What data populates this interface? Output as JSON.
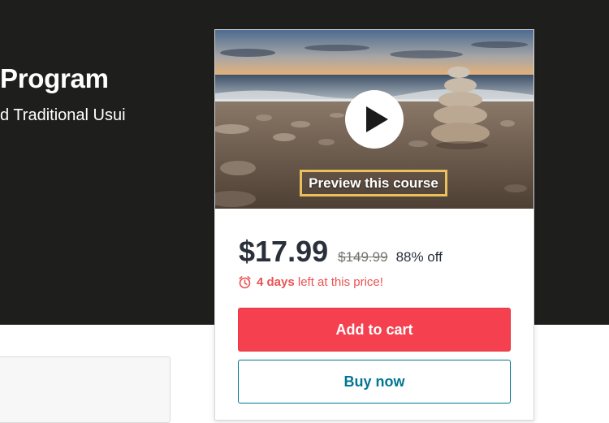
{
  "header": {
    "title": "Program",
    "subtitle": "d Traditional Usui"
  },
  "preview": {
    "label": "Preview this course",
    "icon": "play-icon"
  },
  "pricing": {
    "current": "$17.99",
    "original": "$149.99",
    "discount": "88% off",
    "deadline_bold": "4 days",
    "deadline_rest": " left at this price!",
    "deadline_icon": "alarm-clock-icon"
  },
  "actions": {
    "add_to_cart": "Add to cart",
    "buy_now": "Buy now"
  },
  "colors": {
    "hero_background": "#1e1e1c",
    "cart_button": "#f5414f",
    "buy_button_text": "#007791",
    "deadline_text": "#ec5252",
    "preview_border": "#e8c15c"
  }
}
